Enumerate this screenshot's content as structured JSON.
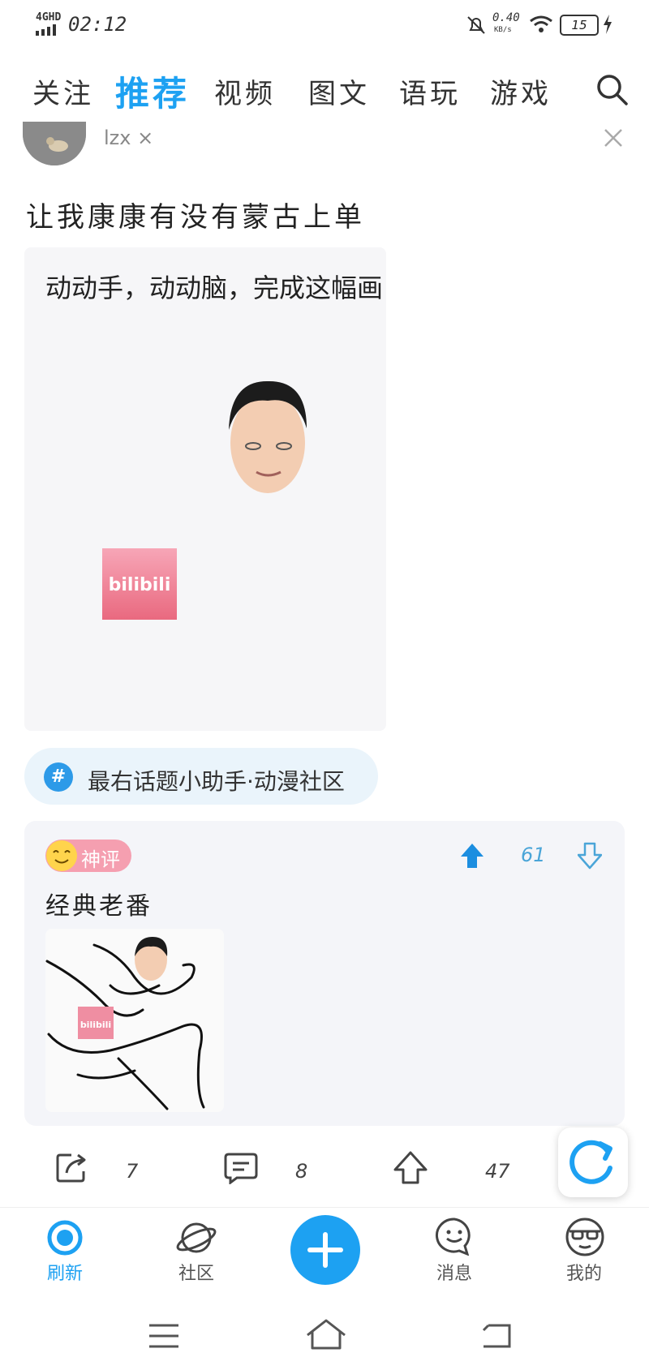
{
  "status_bar": {
    "network": "4GHD",
    "time": "02:12",
    "speed_value": "0.40",
    "speed_unit": "KB/s",
    "battery": "15"
  },
  "tabs": [
    {
      "label": "关注"
    },
    {
      "label": "推荐"
    },
    {
      "label": "视频"
    },
    {
      "label": "图文"
    },
    {
      "label": "语玩"
    },
    {
      "label": "游戏"
    }
  ],
  "post": {
    "username": "lzx ×",
    "text": "让我康康有没有蒙古上单",
    "image_caption": "动动手，动动脑，完成这幅画",
    "topic": "最右话题小助手·动漫社区",
    "topic_icon": "#"
  },
  "comment": {
    "badge": "神评",
    "votes": "61",
    "text": "经典老番"
  },
  "actions": {
    "share_count": "7",
    "comment_count": "8",
    "upvote_count": "47"
  },
  "bottom_nav": [
    {
      "label": "刷新"
    },
    {
      "label": "社区"
    },
    {
      "label": "消息"
    },
    {
      "label": "我的"
    }
  ],
  "colors": {
    "accent": "#1da1f2",
    "badge": "#f59fb0",
    "card_bg": "#f4f5f9"
  }
}
